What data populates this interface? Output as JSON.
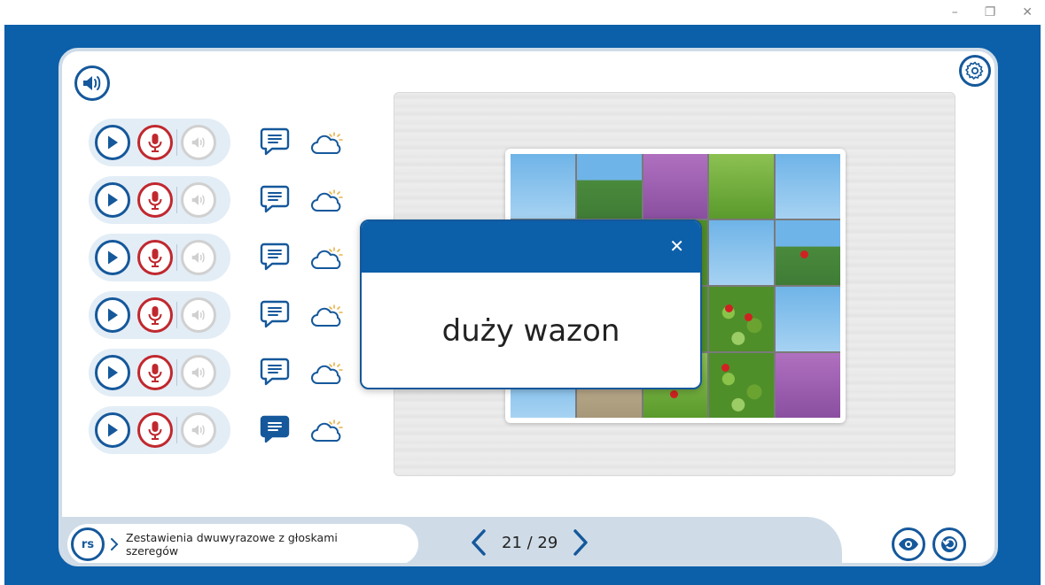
{
  "window": {
    "minimize_label": "–",
    "restore_label": "❐",
    "close_label": "✕"
  },
  "colors": {
    "frame": "#0c5fa9",
    "primary": "#15589b",
    "record": "#c0282e",
    "disabled": "#d0d0d0",
    "panel": "#cfdce8",
    "row_pill": "#e3edf6"
  },
  "toolbar": {
    "speaker_icon": "speaker-icon",
    "settings_icon": "gear-icon"
  },
  "rows": [
    {
      "bubble_active": false
    },
    {
      "bubble_active": false
    },
    {
      "bubble_active": false
    },
    {
      "bubble_active": false
    },
    {
      "bubble_active": false
    },
    {
      "bubble_active": true
    }
  ],
  "modal": {
    "text": "duży wazon",
    "close_label": "✕"
  },
  "footer": {
    "badge": "rs",
    "topic": "Zestawienia dwuwyrazowe z głoskami szeregów",
    "page_text": "21 / 29"
  }
}
